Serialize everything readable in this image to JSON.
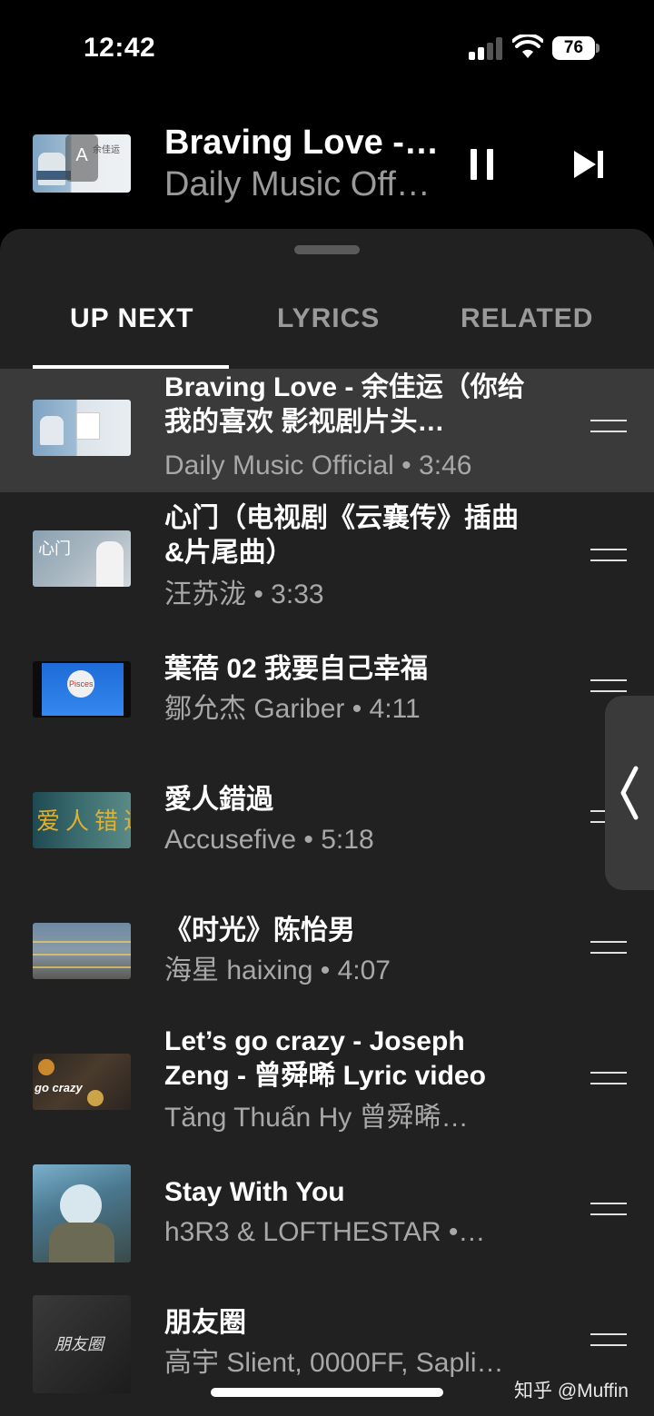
{
  "status_bar": {
    "time": "12:42",
    "battery": "76"
  },
  "mini_player": {
    "title": "Braving Love -…",
    "artist": "Daily Music Off…",
    "art_overlay": "A",
    "art_caption": "余佳运"
  },
  "tabs": [
    {
      "label": "UP NEXT",
      "active": true
    },
    {
      "label": "LYRICS",
      "active": false
    },
    {
      "label": "RELATED",
      "active": false
    }
  ],
  "queue": [
    {
      "title": "Braving Love - 余佳运（你给我的喜欢 影视剧片头…",
      "meta": "Daily Music Official • 3:46",
      "current": true
    },
    {
      "title": "心门（电视剧《云襄传》插曲&片尾曲）",
      "meta": "汪苏泷 • 3:33",
      "thumb_text": "心门"
    },
    {
      "title": "葉蓓 02 我要自己幸福",
      "meta": "鄒允杰 Gariber • 4:11",
      "thumb_text": "Pisces"
    },
    {
      "title": "愛人錯過",
      "meta": "Accusefive • 5:18",
      "thumb_text": "爱人错过"
    },
    {
      "title": "《时光》陈怡男",
      "meta": "海星 haixing • 4:07"
    },
    {
      "title": "Let’s go crazy - Joseph Zeng - 曾舜晞 Lyric video",
      "meta": "Tăng Thuấn Hy 曾舜晞…",
      "thumb_text": "go crazy"
    },
    {
      "title": "Stay With You",
      "meta": "h3R3 & LOFTHESTAR •…"
    },
    {
      "title": "朋友圈",
      "meta": "高宇 Slient, 0000FF, Sapli…",
      "thumb_text": "朋友圈"
    }
  ],
  "watermark": "知乎 @Muffin",
  "colors": {
    "background": "#000000",
    "sheet": "#212121",
    "current_row": "#3a3a3a",
    "secondary_text": "#9a9a9a"
  }
}
